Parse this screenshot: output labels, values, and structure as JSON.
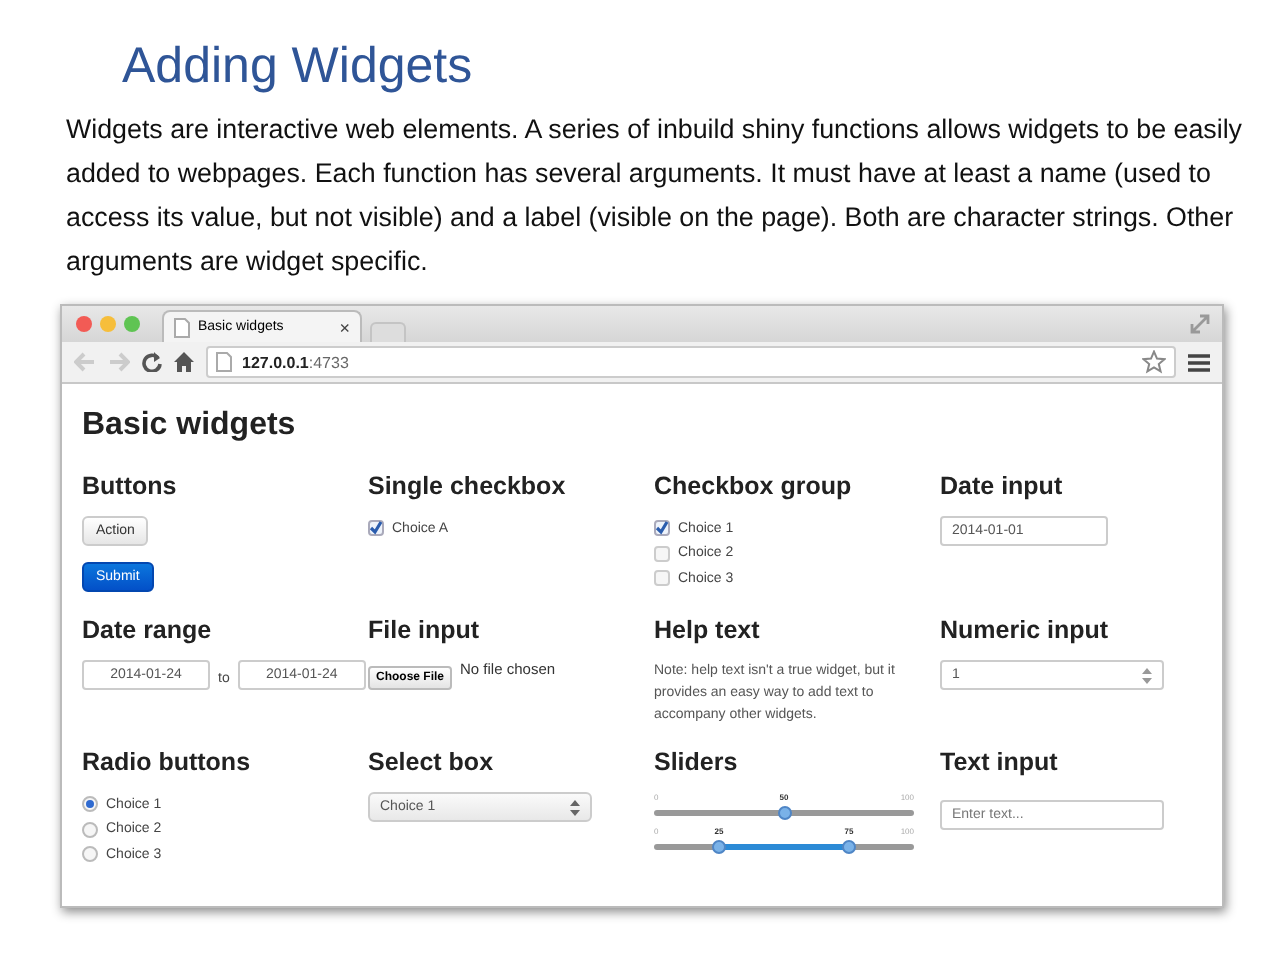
{
  "slide": {
    "title": "Adding Widgets",
    "paragraph": "Widgets are interactive web elements. A series of inbuild shiny functions allows widgets to be easily added to webpages. Each function has several arguments. It must have at least a name (used to access its value, but not visible) and a label (visible on the page). Both are character strings. Other arguments are widget specific."
  },
  "browser": {
    "tab": {
      "title": "Basic widgets",
      "close": "×"
    },
    "address": {
      "host": "127.0.0.1",
      "port": ":4733"
    }
  },
  "page": {
    "heading": "Basic widgets",
    "sections": [
      {
        "kind": "buttons",
        "title": "Buttons",
        "buttons": [
          {
            "label": "Action",
            "primary": false
          },
          {
            "label": "Submit",
            "primary": true
          }
        ]
      },
      {
        "kind": "checkboxes",
        "title": "Single checkbox",
        "options": [
          {
            "label": "Choice A",
            "checked": true
          }
        ]
      },
      {
        "kind": "checkboxes",
        "title": "Checkbox group",
        "options": [
          {
            "label": "Choice 1",
            "checked": true
          },
          {
            "label": "Choice 2",
            "checked": false
          },
          {
            "label": "Choice 3",
            "checked": false
          }
        ]
      },
      {
        "kind": "fields",
        "title": "Date input",
        "fields": [
          {
            "value": "2014-01-01"
          }
        ]
      },
      {
        "kind": "daterange",
        "title": "Date range",
        "start": "2014-01-24",
        "separator": "to",
        "end": "2014-01-24"
      },
      {
        "kind": "file",
        "title": "File input",
        "button": "Choose File",
        "status": "No file chosen"
      },
      {
        "kind": "help",
        "title": "Help text",
        "text": "Note: help text isn't a true widget, but it provides an easy way to add text to accompany other widgets."
      },
      {
        "kind": "numeric",
        "title": "Numeric input",
        "value": "1"
      },
      {
        "kind": "radios",
        "title": "Radio buttons",
        "options": [
          {
            "label": "Choice 1",
            "selected": true
          },
          {
            "label": "Choice 2",
            "selected": false
          },
          {
            "label": "Choice 3",
            "selected": false
          }
        ]
      },
      {
        "kind": "select",
        "title": "Select box",
        "value": "Choice 1"
      },
      {
        "kind": "sliders",
        "title": "Sliders",
        "sliders": [
          {
            "min": "0",
            "max": "100",
            "handles": [
              {
                "label": "50",
                "level": 0.5
              }
            ]
          },
          {
            "min": "0",
            "max": "100",
            "handles": [
              {
                "label": "25",
                "level": 0.25
              },
              {
                "label": "75",
                "level": 0.75
              }
            ]
          }
        ]
      },
      {
        "kind": "textinput",
        "title": "Text input",
        "placeholder": "Enter text..."
      }
    ]
  }
}
